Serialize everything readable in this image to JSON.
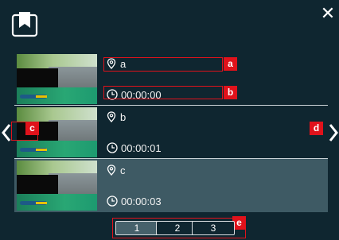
{
  "header": {
    "bookmark_icon": "bookmark-icon",
    "close_label": "✕"
  },
  "entries": [
    {
      "location": "a",
      "time": "00:00:00",
      "selected": false
    },
    {
      "location": "b",
      "time": "00:00:01",
      "selected": false
    },
    {
      "location": "c",
      "time": "00:00:03",
      "selected": true
    }
  ],
  "nav": {
    "prev_icon": "chevron-left-icon",
    "next_icon": "chevron-right-icon"
  },
  "pagination": {
    "pages": [
      "1",
      "2",
      "3"
    ],
    "active_page": "1"
  },
  "callouts": {
    "a": "a",
    "b": "b",
    "c": "c",
    "d": "d",
    "e": "e"
  },
  "colors": {
    "background": "#0f2630",
    "selected_row": "#3e5a64",
    "callout": "#e0121b",
    "text": "#f2f2f2"
  }
}
